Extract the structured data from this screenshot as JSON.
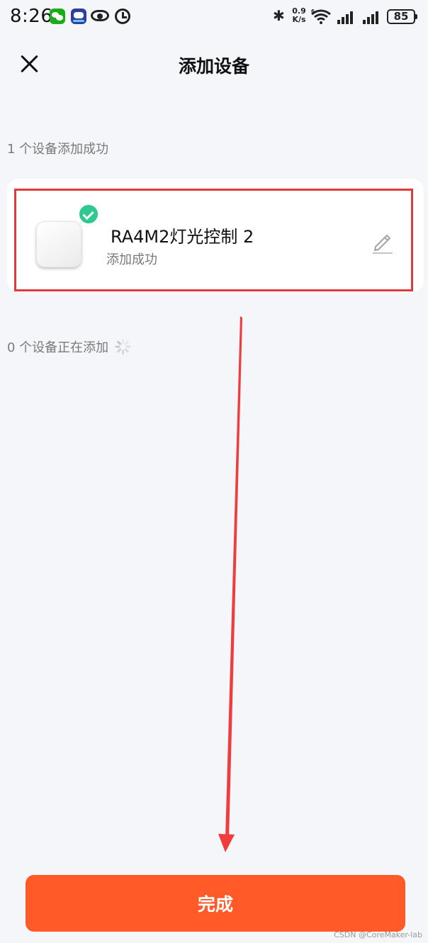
{
  "status_bar": {
    "time": "8:26",
    "network_speed_value": "0.9",
    "network_speed_unit": "K/s",
    "wifi_label": "6",
    "battery": "85",
    "icons": [
      "wechat-icon",
      "robot-app-icon",
      "eye-icon",
      "alarm-icon",
      "bluetooth-icon",
      "wifi-icon",
      "signal-icon",
      "signal-icon",
      "battery-icon"
    ]
  },
  "header": {
    "title": "添加设备",
    "close_icon": "close-icon"
  },
  "success_section": {
    "label": "1 个设备添加成功"
  },
  "device": {
    "name": "RA4M2灯光控制 2",
    "status": "添加成功",
    "badge_icon": "check-icon",
    "edit_icon": "pencil-icon"
  },
  "adding_section": {
    "label": "0 个设备正在添加",
    "spinner_icon": "spinner-icon"
  },
  "footer": {
    "done_label": "完成"
  },
  "watermark": "CSDN @CoreMaker-lab",
  "colors": {
    "accent": "#ff5a28",
    "success": "#2ec98e",
    "annotation": "#e23a3a",
    "background": "#f5f6fa"
  }
}
